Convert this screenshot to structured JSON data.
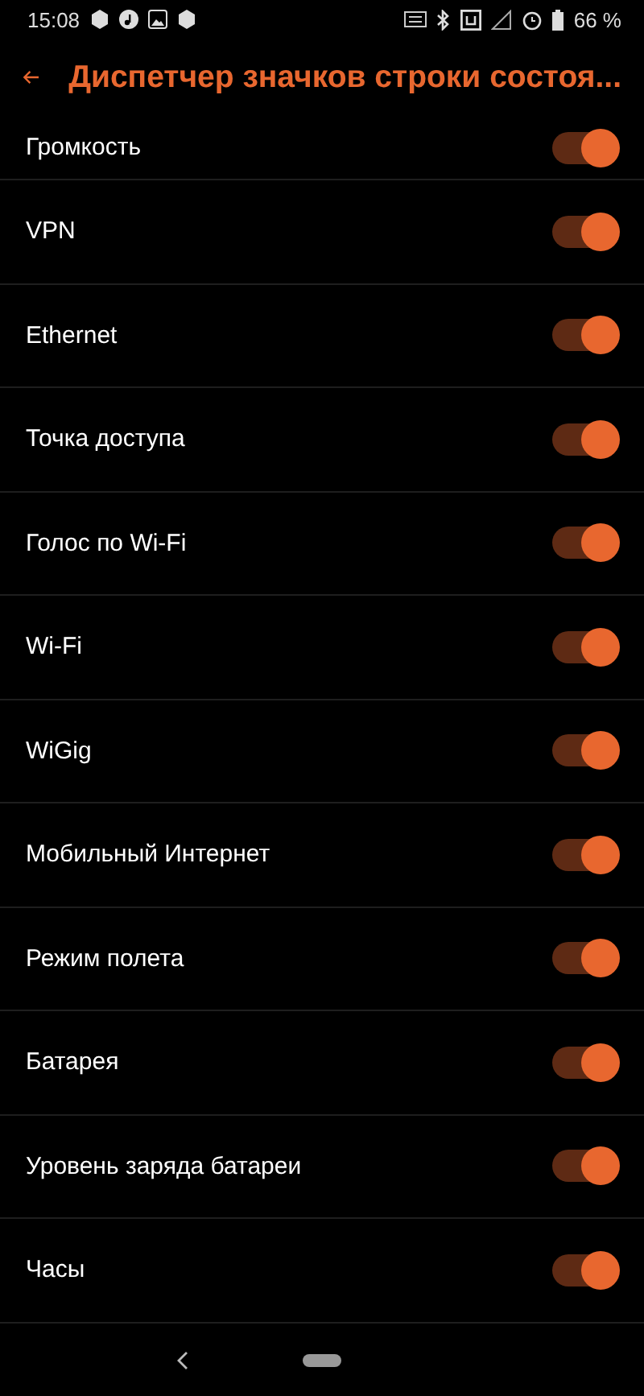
{
  "status_bar": {
    "time": "15:08",
    "battery": "66 %"
  },
  "header": {
    "title": "Диспетчер значков строки состоя..."
  },
  "items": [
    {
      "label": "Громкость",
      "on": true
    },
    {
      "label": "VPN",
      "on": true
    },
    {
      "label": "Ethernet",
      "on": true
    },
    {
      "label": "Точка доступа",
      "on": true
    },
    {
      "label": "Голос по Wi-Fi",
      "on": true
    },
    {
      "label": "Wi-Fi",
      "on": true
    },
    {
      "label": "WiGig",
      "on": true
    },
    {
      "label": "Мобильный Интернет",
      "on": true
    },
    {
      "label": "Режим полета",
      "on": true
    },
    {
      "label": "Батарея",
      "on": true
    },
    {
      "label": "Уровень заряда батареи",
      "on": true
    },
    {
      "label": "Часы",
      "on": true
    }
  ]
}
